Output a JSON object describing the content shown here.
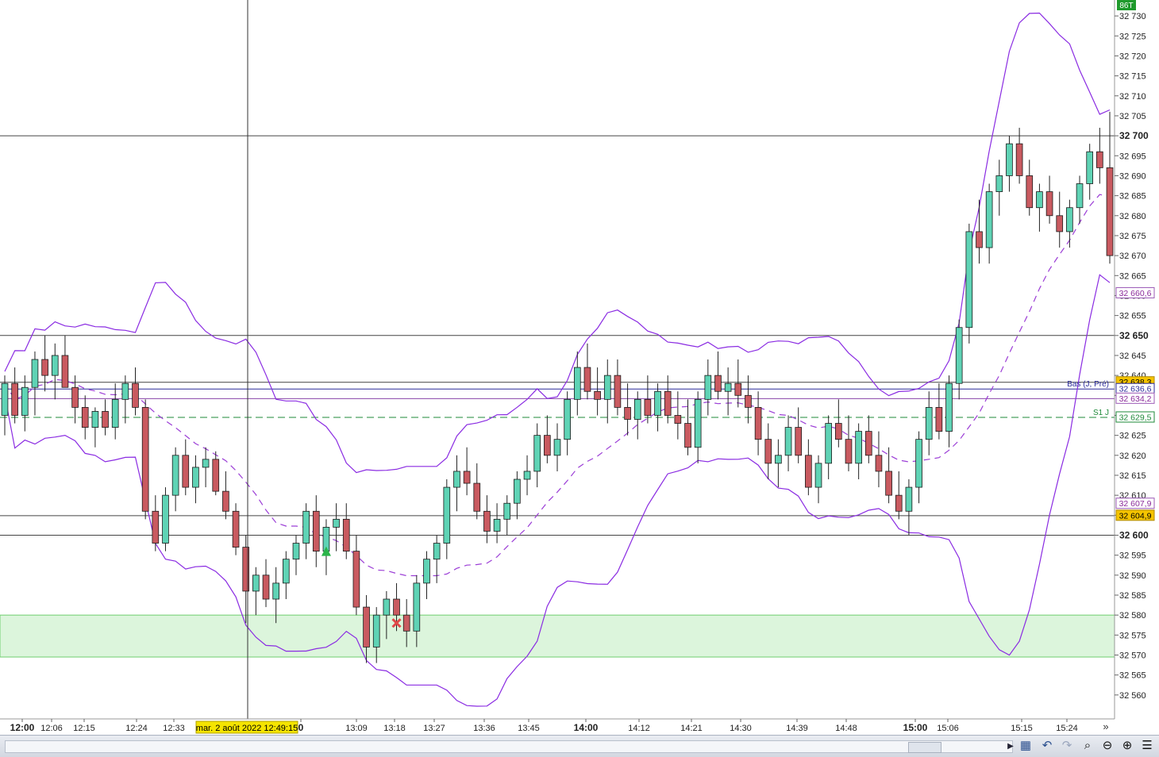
{
  "chart_data": {
    "type": "candlestick",
    "timeframe_badge": "86T",
    "y_axis": {
      "min": 32555,
      "max": 32733,
      "ticks": [
        32560,
        32565,
        32570,
        32575,
        32580,
        32585,
        32590,
        32595,
        32600,
        32605,
        32610,
        32615,
        32620,
        32625,
        32630,
        32635,
        32640,
        32645,
        32650,
        32655,
        32660,
        32665,
        32670,
        32675,
        32680,
        32685,
        32690,
        32695,
        32700,
        32705,
        32710,
        32715,
        32720,
        32725,
        32730
      ],
      "bold_ticks": [
        32600,
        32650,
        32700
      ]
    },
    "x_labels": [
      {
        "label": "12:00",
        "bold": true
      },
      {
        "label": "12:06",
        "bold": false
      },
      {
        "label": "12:15",
        "bold": false
      },
      {
        "label": "12:24",
        "bold": false
      },
      {
        "label": "12:33",
        "bold": false
      },
      {
        "label": "0",
        "bold": true
      },
      {
        "label": "13:09",
        "bold": false
      },
      {
        "label": "13:18",
        "bold": false
      },
      {
        "label": "13:27",
        "bold": false
      },
      {
        "label": "13:36",
        "bold": false
      },
      {
        "label": "13:45",
        "bold": false
      },
      {
        "label": "14:00",
        "bold": true
      },
      {
        "label": "14:12",
        "bold": false
      },
      {
        "label": "14:21",
        "bold": false
      },
      {
        "label": "14:30",
        "bold": false
      },
      {
        "label": "14:39",
        "bold": false
      },
      {
        "label": "14:48",
        "bold": false
      },
      {
        "label": "15:00",
        "bold": true
      },
      {
        "label": "15:06",
        "bold": false
      },
      {
        "label": "15:15",
        "bold": false
      },
      {
        "label": "15:24",
        "bold": false
      }
    ],
    "crosshair": {
      "date_label": "mar. 2 août 2022 12:49:15",
      "price": 32700
    },
    "horizontal_lines": [
      {
        "price": 32700,
        "color": "#444444",
        "style": "solid"
      },
      {
        "price": 32650,
        "color": "#444444",
        "style": "solid"
      },
      {
        "price": 32638.3,
        "color": "#444444",
        "style": "solid"
      },
      {
        "price": 32636.6,
        "color": "#2a2a9a",
        "style": "solid"
      },
      {
        "price": 32634.2,
        "color": "#8844aa",
        "style": "solid"
      },
      {
        "price": 32629.5,
        "color": "#1f8a3a",
        "style": "dashed"
      },
      {
        "price": 32604.9,
        "color": "#444444",
        "style": "solid"
      },
      {
        "price": 32600,
        "color": "#444444",
        "style": "solid"
      }
    ],
    "line_labels": [
      {
        "text": "Bas (J, Pré)",
        "price": 32636.6,
        "color": "#2a2a9a"
      },
      {
        "text": "S1 J",
        "price": 32629.5,
        "color": "#1f8a3a"
      }
    ],
    "zone": {
      "from": 32569.5,
      "to": 32580,
      "fill": "#dcf5dc",
      "stroke": "#6fce6f"
    },
    "price_tags": [
      {
        "text": "32 660,6",
        "price": 32660.6,
        "bg": "#ffffff",
        "fg": "#8a2a9a",
        "border": "#9b59b6"
      },
      {
        "text": "32 638,3",
        "price": 32638.3,
        "bg": "#f5c400",
        "fg": "#000000",
        "border": "#b08a00"
      },
      {
        "text": "32 636,6",
        "price": 32636.6,
        "bg": "#ffffff",
        "fg": "#2a2a9a",
        "border": "#2a2a9a"
      },
      {
        "text": "32 634,2",
        "price": 32634.2,
        "bg": "#ffffff",
        "fg": "#8a2a9a",
        "border": "#9b59b6"
      },
      {
        "text": "32 629,5",
        "price": 32629.5,
        "bg": "#ffffff",
        "fg": "#1f8a3a",
        "border": "#1f8a3a"
      },
      {
        "text": "32 607,9",
        "price": 32607.9,
        "bg": "#ffffff",
        "fg": "#8a2a9a",
        "border": "#9b59b6"
      },
      {
        "text": "32 604,9",
        "price": 32604.9,
        "bg": "#f5c400",
        "fg": "#000000",
        "border": "#b08a00"
      }
    ],
    "markers": [
      {
        "type": "buy-arrow",
        "bar": 32,
        "price": 32596,
        "color": "#2bb44a"
      },
      {
        "type": "exit-cross",
        "bar": 39,
        "price": 32578,
        "color": "#e04848"
      }
    ],
    "colors": {
      "up": "#5fd3b5",
      "down": "#c95a60",
      "wick": "#222222",
      "band": "#8a2be2",
      "mid": "#9b3dd6",
      "crosshair": "#333333"
    },
    "candles": [
      [
        32630,
        32640,
        32625,
        32638
      ],
      [
        32638,
        32642,
        32628,
        32630
      ],
      [
        32630,
        32640,
        32626,
        32637
      ],
      [
        32637,
        32646,
        32630,
        32644
      ],
      [
        32644,
        32650,
        32636,
        32640
      ],
      [
        32640,
        32648,
        32634,
        32645
      ],
      [
        32645,
        32650,
        32637,
        32637
      ],
      [
        32637,
        32640,
        32628,
        32632
      ],
      [
        32632,
        32635,
        32624,
        32627
      ],
      [
        32627,
        32632,
        32622,
        32631
      ],
      [
        32631,
        32634,
        32625,
        32627
      ],
      [
        32627,
        32638,
        32624,
        32634
      ],
      [
        32634,
        32640,
        32628,
        32638
      ],
      [
        32638,
        32642,
        32630,
        32632
      ],
      [
        32632,
        32634,
        32604,
        32606
      ],
      [
        32606,
        32610,
        32596,
        32598
      ],
      [
        32598,
        32612,
        32596,
        32610
      ],
      [
        32610,
        32622,
        32606,
        32620
      ],
      [
        32620,
        32624,
        32610,
        32612
      ],
      [
        32612,
        32620,
        32608,
        32617
      ],
      [
        32617,
        32622,
        32612,
        32619
      ],
      [
        32619,
        32621,
        32610,
        32611
      ],
      [
        32611,
        32616,
        32604,
        32606
      ],
      [
        32606,
        32608,
        32595,
        32597
      ],
      [
        32597,
        32600,
        32578,
        32586
      ],
      [
        32586,
        32592,
        32580,
        32590
      ],
      [
        32590,
        32594,
        32582,
        32584
      ],
      [
        32584,
        32592,
        32578,
        32588
      ],
      [
        32588,
        32596,
        32584,
        32594
      ],
      [
        32594,
        32600,
        32590,
        32598
      ],
      [
        32598,
        32608,
        32594,
        32606
      ],
      [
        32606,
        32610,
        32592,
        32596
      ],
      [
        32596,
        32604,
        32590,
        32602
      ],
      [
        32602,
        32608,
        32596,
        32604
      ],
      [
        32604,
        32608,
        32594,
        32596
      ],
      [
        32596,
        32600,
        32580,
        32582
      ],
      [
        32582,
        32585,
        32568,
        32572
      ],
      [
        32572,
        32582,
        32568,
        32580
      ],
      [
        32580,
        32586,
        32574,
        32584
      ],
      [
        32584,
        32588,
        32576,
        32580
      ],
      [
        32580,
        32584,
        32572,
        32576
      ],
      [
        32576,
        32590,
        32572,
        32588
      ],
      [
        32588,
        32596,
        32584,
        32594
      ],
      [
        32594,
        32600,
        32588,
        32598
      ],
      [
        32598,
        32614,
        32594,
        32612
      ],
      [
        32612,
        32620,
        32606,
        32616
      ],
      [
        32616,
        32622,
        32610,
        32613
      ],
      [
        32613,
        32618,
        32604,
        32606
      ],
      [
        32606,
        32610,
        32598,
        32601
      ],
      [
        32601,
        32608,
        32598,
        32604
      ],
      [
        32604,
        32610,
        32600,
        32608
      ],
      [
        32608,
        32616,
        32604,
        32614
      ],
      [
        32614,
        32620,
        32610,
        32616
      ],
      [
        32616,
        32628,
        32612,
        32625
      ],
      [
        32625,
        32630,
        32618,
        32620
      ],
      [
        32620,
        32628,
        32616,
        32624
      ],
      [
        32624,
        32636,
        32620,
        32634
      ],
      [
        32634,
        32646,
        32630,
        32642
      ],
      [
        32642,
        32648,
        32634,
        32636
      ],
      [
        32636,
        32642,
        32630,
        32634
      ],
      [
        32634,
        32644,
        32628,
        32640
      ],
      [
        32640,
        32644,
        32630,
        32632
      ],
      [
        32632,
        32638,
        32625,
        32629
      ],
      [
        32629,
        32636,
        32624,
        32634
      ],
      [
        32634,
        32640,
        32628,
        32630
      ],
      [
        32630,
        32638,
        32626,
        32636
      ],
      [
        32636,
        32640,
        32628,
        32630
      ],
      [
        32630,
        32636,
        32624,
        32628
      ],
      [
        32628,
        32634,
        32620,
        32622
      ],
      [
        32622,
        32636,
        32618,
        32634
      ],
      [
        32634,
        32644,
        32630,
        32640
      ],
      [
        32640,
        32646,
        32634,
        32636
      ],
      [
        32636,
        32642,
        32630,
        32638
      ],
      [
        32638,
        32644,
        32632,
        32635
      ],
      [
        32635,
        32640,
        32628,
        32632
      ],
      [
        32632,
        32636,
        32620,
        32624
      ],
      [
        32624,
        32628,
        32614,
        32618
      ],
      [
        32618,
        32624,
        32612,
        32620
      ],
      [
        32620,
        32630,
        32616,
        32627
      ],
      [
        32627,
        32632,
        32618,
        32620
      ],
      [
        32620,
        32624,
        32610,
        32612
      ],
      [
        32612,
        32620,
        32608,
        32618
      ],
      [
        32618,
        32630,
        32614,
        32628
      ],
      [
        32628,
        32634,
        32622,
        32624
      ],
      [
        32624,
        32630,
        32616,
        32618
      ],
      [
        32618,
        32628,
        32614,
        32626
      ],
      [
        32626,
        32630,
        32618,
        32620
      ],
      [
        32620,
        32626,
        32612,
        32616
      ],
      [
        32616,
        32622,
        32608,
        32610
      ],
      [
        32610,
        32616,
        32604,
        32606
      ],
      [
        32606,
        32614,
        32600,
        32612
      ],
      [
        32612,
        32626,
        32608,
        32624
      ],
      [
        32624,
        32636,
        32620,
        32632
      ],
      [
        32632,
        32638,
        32624,
        32626
      ],
      [
        32626,
        32640,
        32622,
        32638
      ],
      [
        32638,
        32654,
        32634,
        32652
      ],
      [
        32652,
        32678,
        32648,
        32676
      ],
      [
        32676,
        32684,
        32668,
        32672
      ],
      [
        32672,
        32688,
        32668,
        32686
      ],
      [
        32686,
        32694,
        32680,
        32690
      ],
      [
        32690,
        32700,
        32686,
        32698
      ],
      [
        32698,
        32702,
        32688,
        32690
      ],
      [
        32690,
        32694,
        32680,
        32682
      ],
      [
        32682,
        32688,
        32676,
        32686
      ],
      [
        32686,
        32690,
        32678,
        32680
      ],
      [
        32680,
        32686,
        32672,
        32676
      ],
      [
        32676,
        32684,
        32672,
        32682
      ],
      [
        32682,
        32690,
        32678,
        32688
      ],
      [
        32688,
        32698,
        32684,
        32696
      ],
      [
        32696,
        32702,
        32688,
        32692
      ],
      [
        32692,
        32706,
        32668,
        32670
      ]
    ]
  },
  "footer": {
    "scroll_right": "▶",
    "more": "»",
    "tool_icons": [
      "calendar-icon",
      "undo-icon",
      "redo-icon",
      "zoom-fit-icon",
      "zoom-out-icon",
      "zoom-in-icon",
      "toolbar-menu-icon"
    ]
  }
}
